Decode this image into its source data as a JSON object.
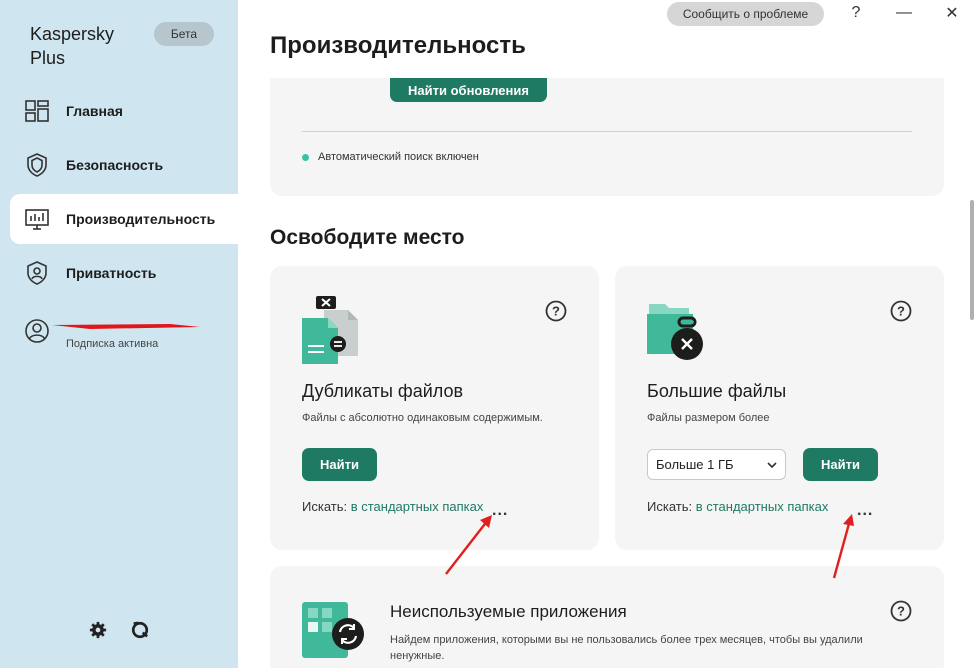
{
  "app": {
    "name": "Kaspersky Plus",
    "badge": "Бета"
  },
  "sidebar": {
    "items": [
      {
        "label": "Главная",
        "icon": "dashboard-icon"
      },
      {
        "label": "Безопасность",
        "icon": "shield-icon"
      },
      {
        "label": "Производительность",
        "icon": "performance-icon",
        "active": true
      },
      {
        "label": "Приватность",
        "icon": "privacy-shield-icon"
      }
    ],
    "account": {
      "subtitle": "Подписка активна"
    },
    "bottom": [
      "gear-icon",
      "support-icon"
    ]
  },
  "titlebar": {
    "report": "Сообщить о проблеме",
    "help": "?",
    "minimize": "—",
    "close": "✕"
  },
  "main": {
    "title": "Производительность",
    "updates": {
      "button": "Найти обновления",
      "status": "Автоматический поиск включен"
    },
    "section": "Освободите место",
    "duplicates": {
      "title": "Дубликаты файлов",
      "desc": "Файлы с абсолютно одинаковым содержимым.",
      "button": "Найти",
      "search_label": "Искать:",
      "search_link": "в стандартных папках",
      "more": "..."
    },
    "large": {
      "title": "Большие файлы",
      "desc": "Файлы размером более",
      "select": "Больше 1 ГБ",
      "button": "Найти",
      "search_label": "Искать:",
      "search_link": "в стандартных папках",
      "more": "..."
    },
    "apps": {
      "title": "Неиспользуемые приложения",
      "desc": "Найдем приложения, которыми вы не пользовались более трех месяцев, чтобы вы удалили ненужные."
    }
  },
  "colors": {
    "accent": "#1f7a63",
    "sidebar": "#cfe6f1",
    "status_dot": "#3cc0a0",
    "annotation": "#e02020"
  }
}
